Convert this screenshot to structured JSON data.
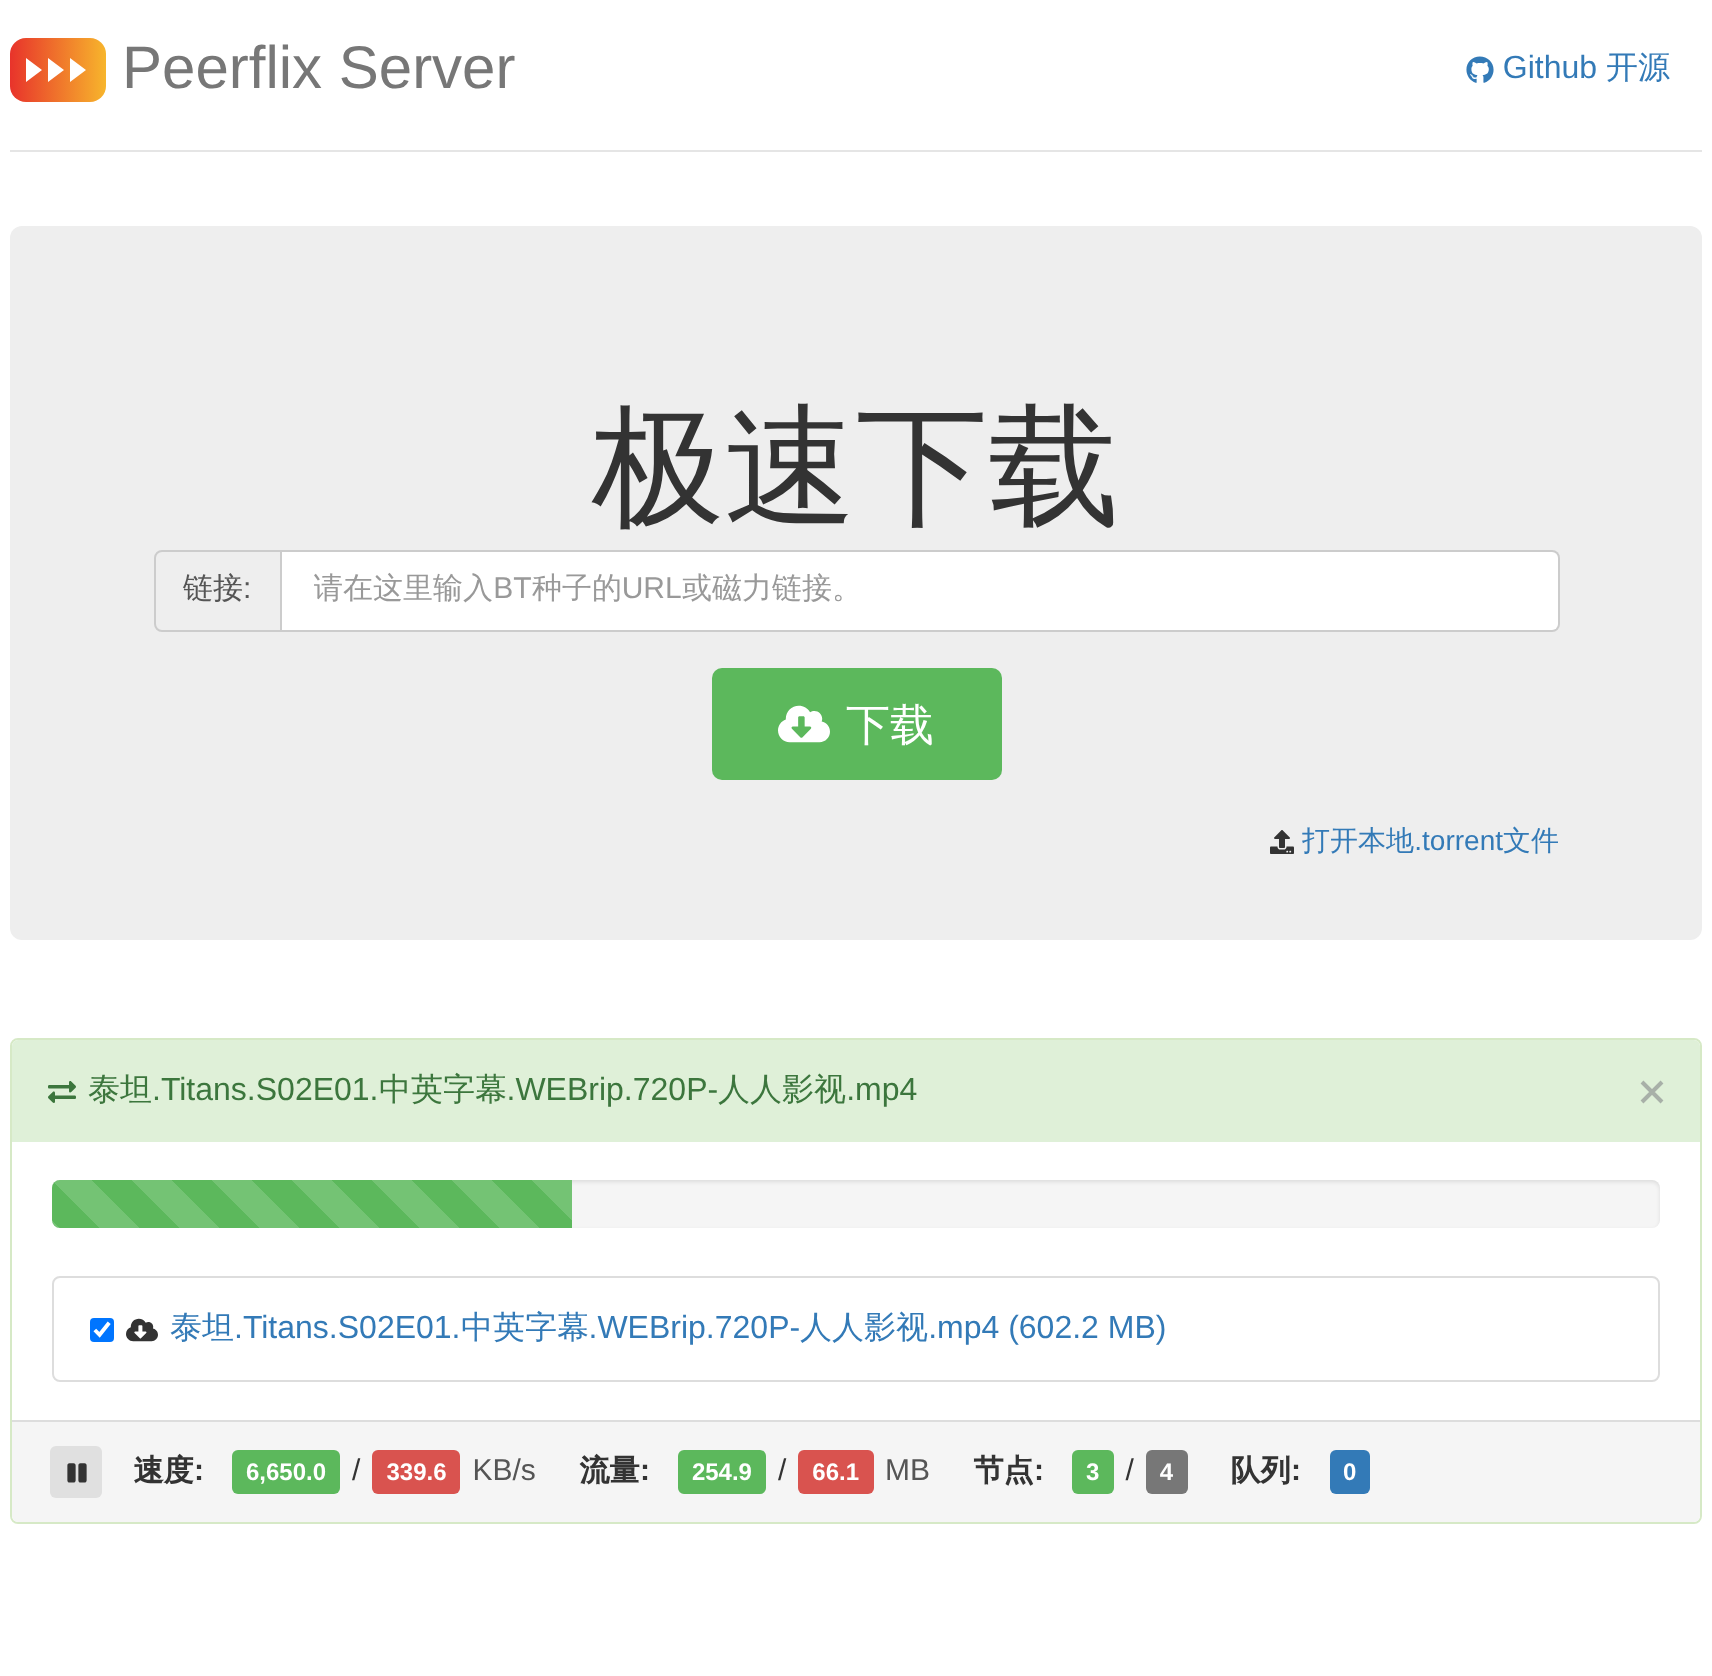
{
  "header": {
    "title": "Peerflix Server",
    "link": "Github 开源"
  },
  "hero": {
    "title": "极速下载",
    "input_label": "链接:",
    "placeholder": "请在这里输入BT种子的URL或磁力链接。",
    "button": "下载",
    "upload_link": "打开本地.torrent文件"
  },
  "torrent": {
    "name": "泰坦.Titans.S02E01.中英字幕.WEBrip.720P-人人影视.mp4",
    "progress": {
      "level": 0.324
    },
    "files": [
      {
        "checked": true,
        "name": "泰坦.Titans.S02E01.中英字幕.WEBrip.720P-人人影视.mp4 (602.2 MB)"
      }
    ],
    "stats": [
      {
        "label": "速度:",
        "badges": [
          {
            "text": "6,650.0",
            "color": "#5cb85c"
          },
          {
            "text": "339.6",
            "color": "#d9534f"
          }
        ],
        "separator": "/",
        "unit": "KB/s"
      },
      {
        "label": "流量:",
        "badges": [
          {
            "text": "254.9",
            "color": "#5cb85c"
          },
          {
            "text": "66.1",
            "color": "#d9534f"
          }
        ],
        "separator": "/",
        "unit": "MB"
      },
      {
        "label": "节点:",
        "badges": [
          {
            "text": "3",
            "color": "#5cb85c"
          },
          {
            "text": "4",
            "color": "#777777"
          }
        ],
        "separator": "/"
      },
      {
        "label": "队列:",
        "badges": [
          {
            "text": "0",
            "color": "#337ab7"
          }
        ]
      }
    ]
  }
}
